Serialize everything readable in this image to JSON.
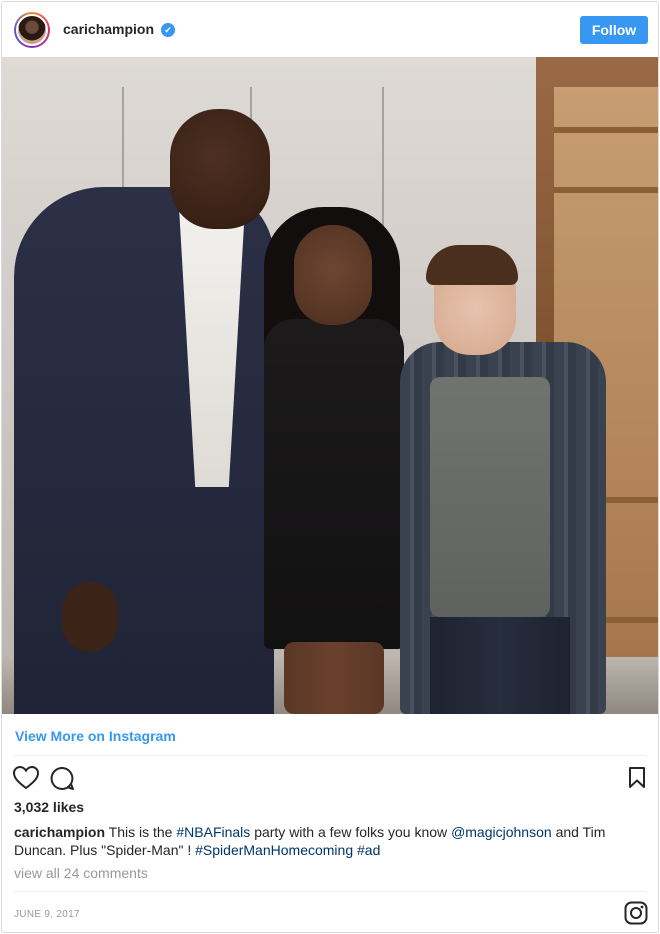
{
  "header": {
    "username": "carichampion",
    "verified_mark": "✔",
    "follow_label": "Follow"
  },
  "post": {
    "view_more_label": "View More on Instagram",
    "likes": "3,032 likes",
    "caption": {
      "user": "carichampion",
      "text_1": "This is the",
      "hashtag_1": "#NBAFinals",
      "text_2": "party with a few folks you know",
      "mention_1": "@magicjohnson",
      "text_3": "and Tim Duncan. Plus \"Spider-Man\" !",
      "hashtag_2": "#SpiderManHomecoming",
      "hashtag_3": "#ad"
    },
    "comments_label": "view all 24 comments",
    "date": "JUNE 9, 2017"
  },
  "icons": {
    "like": "heart-icon",
    "comment": "comment-icon",
    "save": "bookmark-icon",
    "instagram": "instagram-icon",
    "verified": "verified-badge-icon"
  },
  "colors": {
    "accent": "#3897f0",
    "text": "#262626",
    "muted": "#999999",
    "hashtag": "#003569",
    "border": "#dbdbdb"
  }
}
